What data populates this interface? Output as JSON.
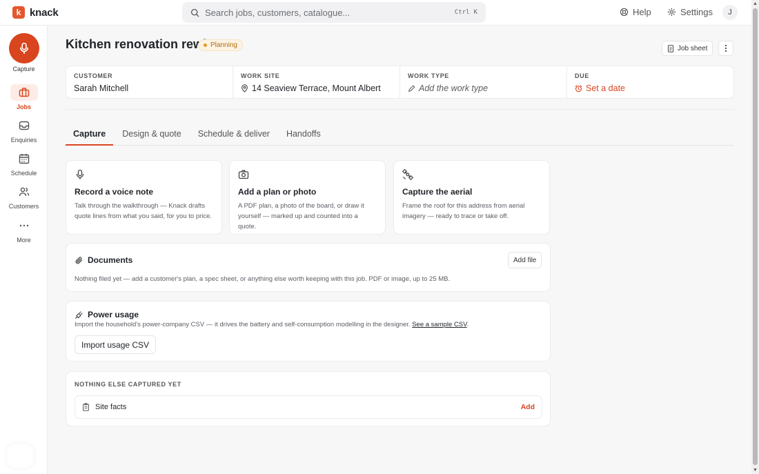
{
  "brand": {
    "logo_letter": "k",
    "name": "knack",
    "accent": "#d8451e"
  },
  "search": {
    "placeholder": "Search jobs, customers, catalogue...",
    "shortcut_mod": "Ctrl",
    "shortcut_key": "K"
  },
  "topnav": {
    "help": "Help",
    "settings": "Settings",
    "avatar": "J"
  },
  "sidebar": {
    "capture": "Capture",
    "items": [
      {
        "label": "Jobs",
        "icon": "briefcase-icon",
        "active": true
      },
      {
        "label": "Enquiries",
        "icon": "inbox-icon",
        "active": false
      },
      {
        "label": "Schedule",
        "icon": "calendar-icon",
        "active": false
      },
      {
        "label": "Customers",
        "icon": "users-icon",
        "active": false
      },
      {
        "label": "More",
        "icon": "more-dots-icon",
        "active": false
      }
    ]
  },
  "job": {
    "title": "Kitchen renovation rewire",
    "status": "Planning",
    "status_color": "#e09a2c",
    "job_sheet": "Job sheet"
  },
  "info": {
    "customer_label": "CUSTOMER",
    "customer_value": "Sarah Mitchell",
    "site_label": "WORK SITE",
    "site_value": "14 Seaview Terrace, Mount Albert",
    "type_label": "WORK TYPE",
    "type_value": "Add the work type",
    "due_label": "DUE",
    "due_value": "Set a date"
  },
  "tabs": [
    "Capture",
    "Design & quote",
    "Schedule & deliver",
    "Handoffs"
  ],
  "actions": [
    {
      "icon": "microphone-icon",
      "title": "Record a voice note",
      "body": "Talk through the walkthrough — Knack drafts quote lines from what you said, for you to price."
    },
    {
      "icon": "camera-icon",
      "title": "Add a plan or photo",
      "body": "A PDF plan, a photo of the board, or draw it yourself — marked up and counted into a quote."
    },
    {
      "icon": "satellite-icon",
      "title": "Capture the aerial",
      "body": "Frame the roof for this address from aerial imagery — ready to trace or take off."
    }
  ],
  "documents": {
    "title": "Documents",
    "add_button": "Add file",
    "empty_text": "Nothing filed yet — add a customer's plan, a spec sheet, or anything else worth keeping with this job. PDF or image, up to 25 MB."
  },
  "power": {
    "title": "Power usage",
    "body": "Import the household's power-company CSV — it drives the battery and self-consumption modelling in the designer.",
    "link": "See a sample CSV",
    "link_suffix": ".",
    "button": "Import usage CSV"
  },
  "nothing": {
    "label": "NOTHING ELSE CAPTURED YET",
    "row_label": "Site facts",
    "row_action": "Add"
  }
}
